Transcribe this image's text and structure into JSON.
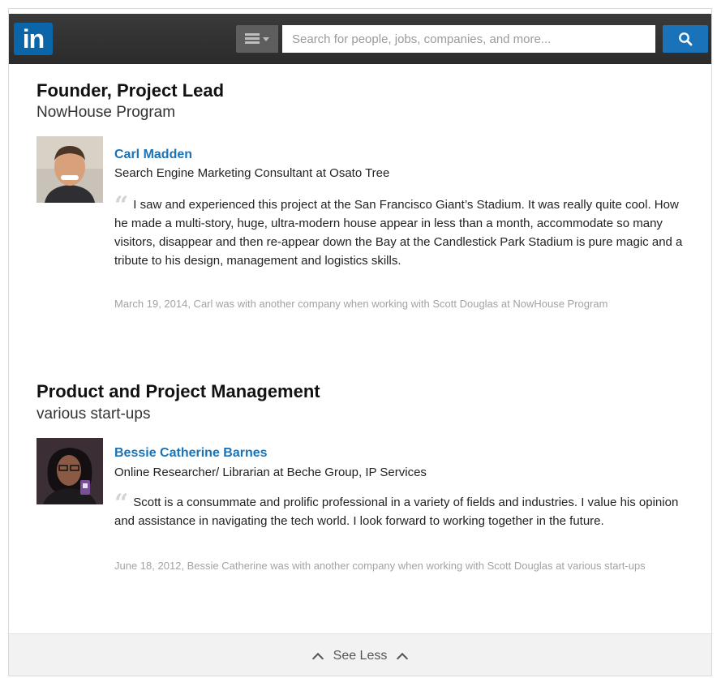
{
  "header": {
    "logo_text": "in",
    "brand_color": "#0a66a8",
    "search_placeholder": "Search for people, jobs, companies, and more...",
    "search_value": "",
    "menu_icon": "menu-icon",
    "search_icon": "search-icon"
  },
  "sections": [
    {
      "title": "Founder, Project Lead",
      "organization": "NowHouse Program",
      "recommendation": {
        "name": "Carl Madden",
        "headline": "Search Engine Marketing Consultant at Osato Tree",
        "text": "I saw and experienced this project at the San Francisco Giant’s Stadium. It was really quite cool. How he made a multi-story, huge, ultra-modern house appear in less than a month, accommodate so many visitors, disappear and then re-appear down the Bay at the Candlestick Park Stadium is pure magic and a tribute to his design, management and logistics skills.",
        "meta": "March 19, 2014, Carl was with another company when working with Scott Douglas at NowHouse Program"
      }
    },
    {
      "title": "Product and Project Management",
      "organization": "various start-ups",
      "recommendation": {
        "name": "Bessie Catherine Barnes",
        "headline": "Online Researcher/ Librarian at Beche Group, IP Services",
        "text": "Scott is a consummate and prolific professional in a variety of fields and industries. I value his opinion and assistance in navigating the tech world. I look forward to working together in the future.",
        "meta": "June 18, 2012, Bessie Catherine was with another company when working with Scott Douglas at various start-ups"
      }
    }
  ],
  "footer": {
    "see_less_label": "See Less"
  },
  "colors": {
    "link": "#1a73b8",
    "topbar": "#2f2f2f",
    "meta_text": "#a3a3a3"
  }
}
